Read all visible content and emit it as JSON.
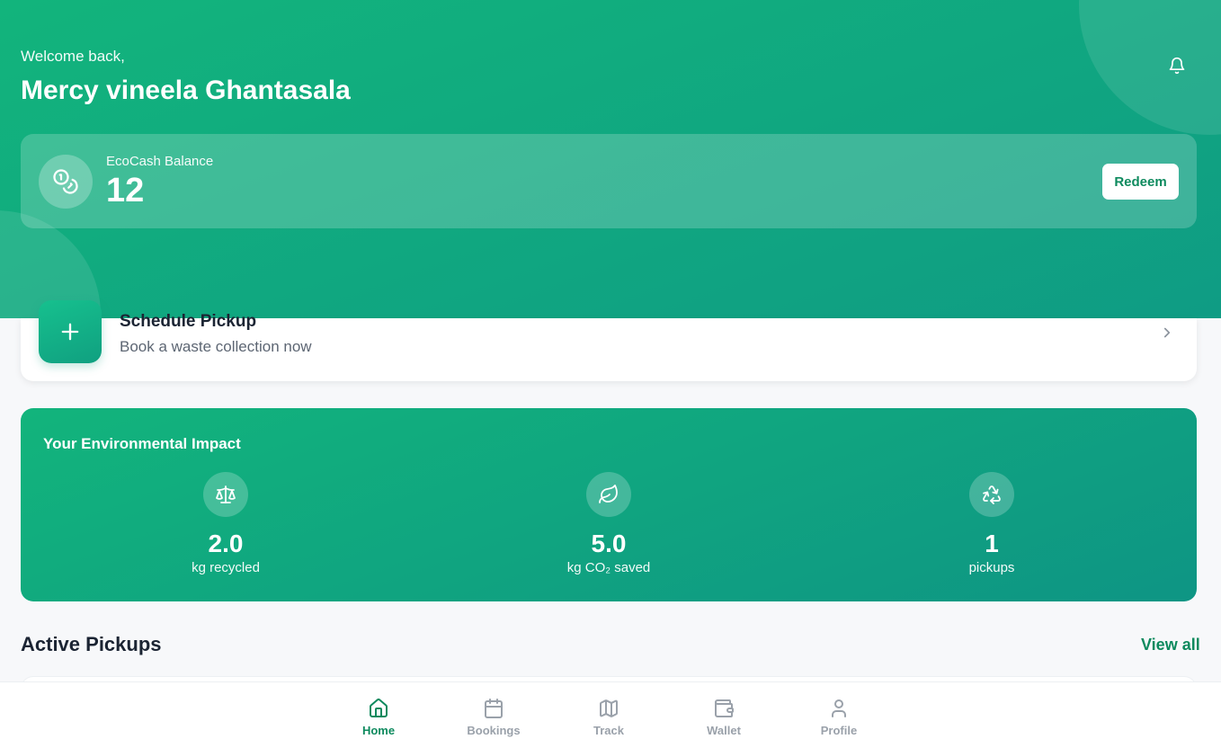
{
  "header": {
    "welcome": "Welcome back,",
    "user_name": "Mercy vineela Ghantasala",
    "notification_icon": "bell-icon"
  },
  "balance": {
    "label": "EcoCash Balance",
    "value": "12",
    "icon": "coins-icon",
    "redeem_label": "Redeem"
  },
  "schedule": {
    "title": "Schedule Pickup",
    "subtitle": "Book a waste collection now",
    "icon": "plus-icon"
  },
  "impact": {
    "title": "Your Environmental Impact",
    "stats": [
      {
        "icon": "scale-icon",
        "value": "2.0",
        "label": "kg recycled"
      },
      {
        "icon": "leaf-icon",
        "value": "5.0",
        "label": "kg CO₂ saved"
      },
      {
        "icon": "recycle-icon",
        "value": "1",
        "label": "pickups"
      }
    ]
  },
  "active_pickups": {
    "title": "Active Pickups",
    "view_all": "View all"
  },
  "nav": {
    "items": [
      {
        "label": "Home",
        "icon": "home-icon",
        "active": true
      },
      {
        "label": "Bookings",
        "icon": "calendar-icon",
        "active": false
      },
      {
        "label": "Track",
        "icon": "map-icon",
        "active": false
      },
      {
        "label": "Wallet",
        "icon": "wallet-icon",
        "active": false
      },
      {
        "label": "Profile",
        "icon": "user-icon",
        "active": false
      }
    ]
  },
  "colors": {
    "primary": "#12b47c",
    "primary_dark": "#0e8a5e",
    "text_dark": "#1b2433",
    "text_muted": "#9aa1aa"
  }
}
